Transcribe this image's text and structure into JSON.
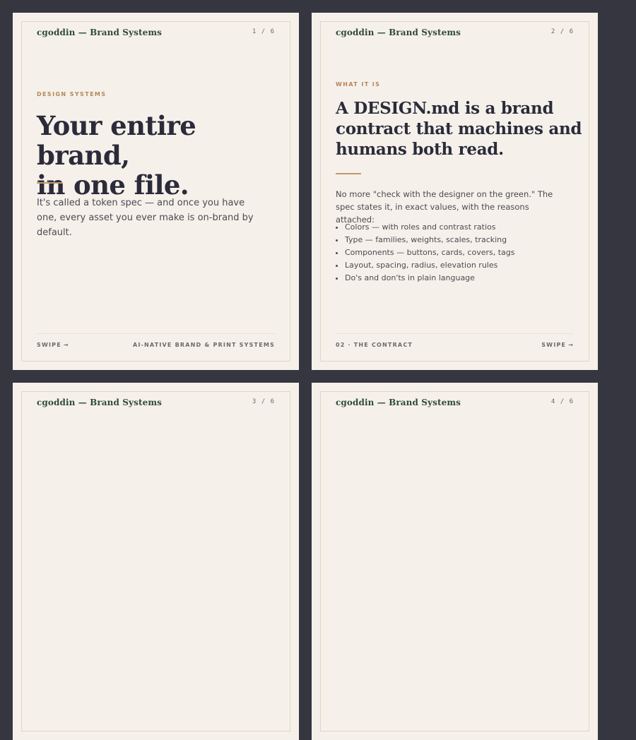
{
  "brand": "cgoddin — Brand Systems",
  "arrow_glyph": "→",
  "card1": {
    "pager": "1 / 6",
    "eyebrow": "DESIGN SYSTEMS",
    "headline_line1": "Your entire brand,",
    "headline_line2": "in one file.",
    "body": "It's called a token spec — and once you have one, every asset you ever make is on-brand by default.",
    "footer_left": "SWIPE",
    "footer_right": "AI-NATIVE BRAND & PRINT SYSTEMS"
  },
  "card2": {
    "pager": "2 / 6",
    "eyebrow": "WHAT IT IS",
    "headline_line1": "A DESIGN.md is a brand",
    "headline_line2": "contract that machines and",
    "headline_line3": "humans both read.",
    "body": "No more \"check with the designer on the green.\" The spec states it, in exact values, with the reasons attached:",
    "points": [
      "Colors — with roles and contrast ratios",
      "Type — families, weights, scales, tracking",
      "Components — buttons, cards, covers, tags",
      "Layout, spacing, radius, elevation rules",
      "Do's and don'ts in plain language"
    ],
    "footer_left": "02 · THE CONTRACT",
    "footer_right": "SWIPE"
  },
  "card3": {
    "pager": "3 / 6"
  },
  "card4": {
    "pager": "4 / 6"
  }
}
